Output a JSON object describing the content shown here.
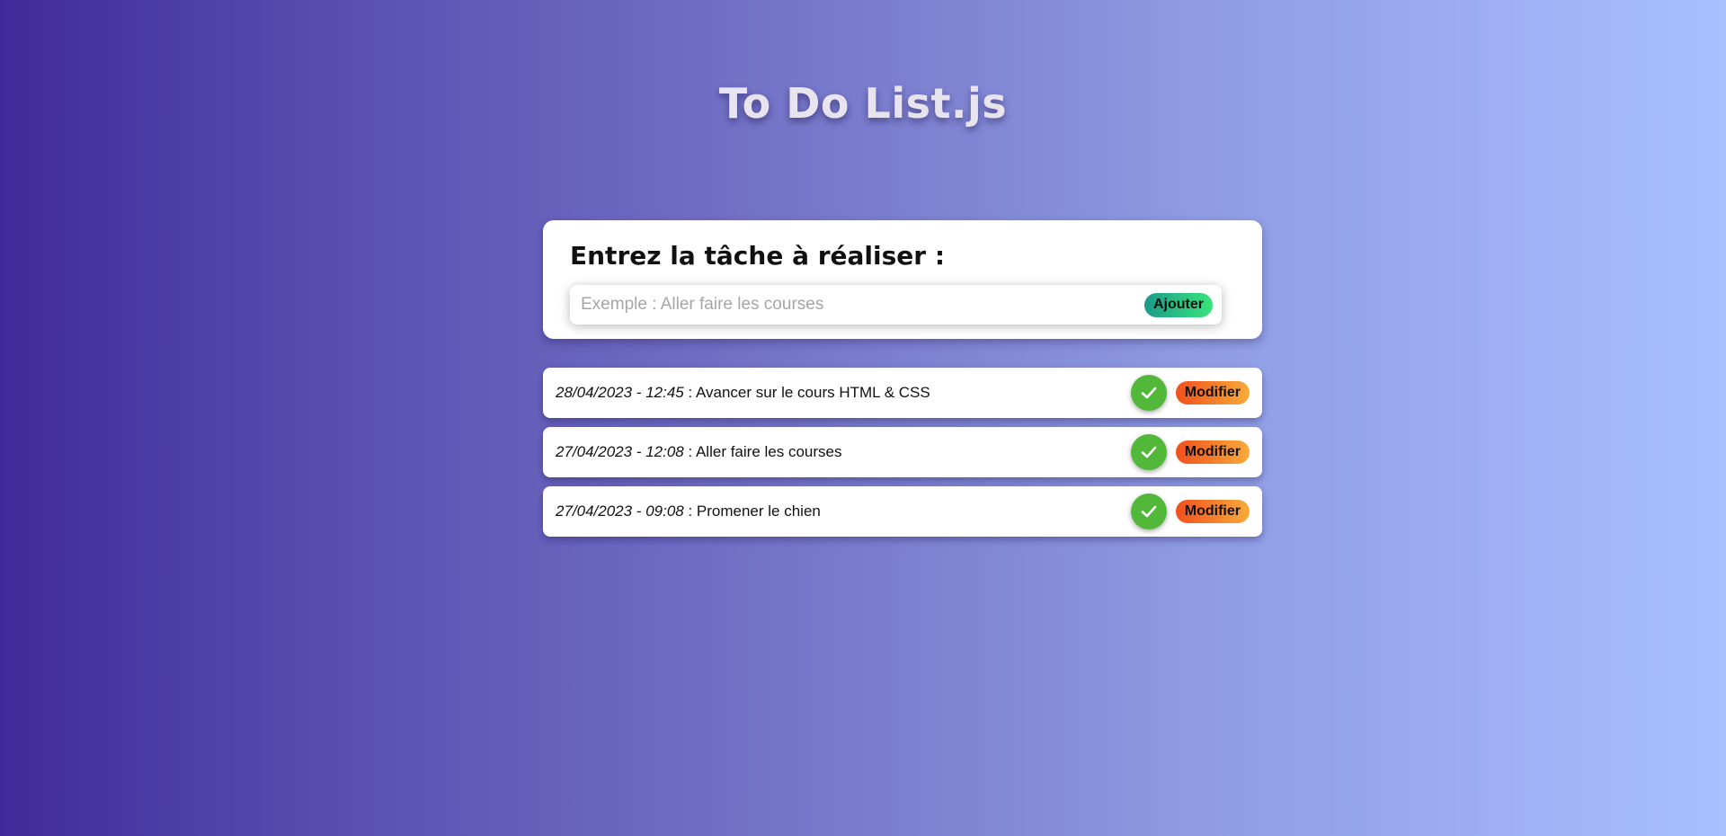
{
  "app": {
    "title": "To Do List.js"
  },
  "form": {
    "heading": "Entrez la tâche à réaliser :",
    "placeholder": "Exemple : Aller faire les courses",
    "value": "",
    "add_label": "Ajouter"
  },
  "tasks": [
    {
      "date": "28/04/2023 - 12:45",
      "separator": " : ",
      "text": "Avancer sur le cours HTML & CSS",
      "done_icon": "check-icon",
      "edit_label": "Modifier"
    },
    {
      "date": "27/04/2023 - 12:08",
      "separator": " : ",
      "text": "Aller faire les courses",
      "done_icon": "check-icon",
      "edit_label": "Modifier"
    },
    {
      "date": "27/04/2023 - 09:08",
      "separator": " : ",
      "text": "Promener le chien",
      "done_icon": "check-icon",
      "edit_label": "Modifier"
    }
  ],
  "colors": {
    "done_button": "#52b83a",
    "add_button_gradient": [
      "#1a9a8a",
      "#39e57a"
    ],
    "edit_button_gradient": [
      "#f1501c",
      "#f8ab3a"
    ]
  }
}
